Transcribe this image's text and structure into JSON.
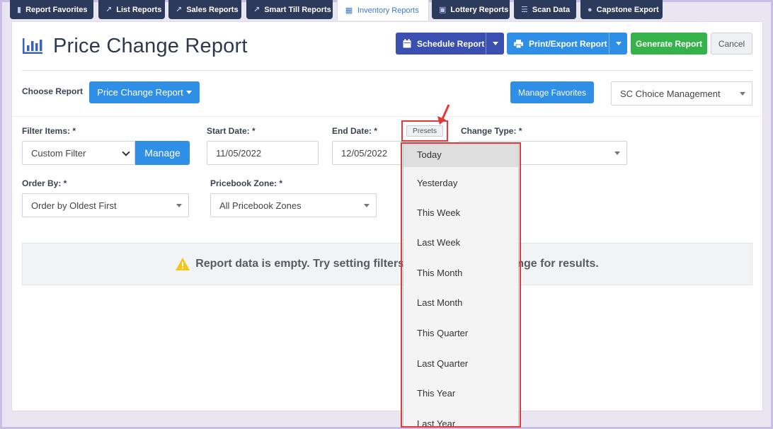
{
  "tabs": [
    {
      "label": "Report Favorites",
      "icon": "bookmark-icon"
    },
    {
      "label": "List Reports",
      "icon": "line-chart-icon"
    },
    {
      "label": "Sales Reports",
      "icon": "line-chart-icon"
    },
    {
      "label": "Smart Till Reports",
      "icon": "line-chart-icon"
    },
    {
      "label": "Inventory Reports",
      "icon": "barcode-icon",
      "active": true
    },
    {
      "label": "Lottery Reports",
      "icon": "ticket-icon"
    },
    {
      "label": "Scan Data",
      "icon": "list-icon"
    },
    {
      "label": "Capstone Export",
      "icon": "users-icon"
    }
  ],
  "header": {
    "title": "Price Change Report",
    "schedule_label": "Schedule Report",
    "print_label": "Print/Export Report",
    "generate_label": "Generate Report",
    "cancel_label": "Cancel"
  },
  "choose": {
    "label": "Choose Report",
    "report_button": "Price Change Report",
    "manage_favorites": "Manage Favorites",
    "company_value": "SC Choice Management"
  },
  "filters": {
    "filter_items_label": "Filter Items: *",
    "filter_items_value": "Custom Filter",
    "manage_label": "Manage",
    "start_label": "Start Date: *",
    "start_value": "11/05/2022",
    "end_label": "End Date: *",
    "end_value": "12/05/2022",
    "presets_label": "Presets",
    "change_type_label": "Change Type: *",
    "order_by_label": "Order By: *",
    "order_by_value": "Order by Oldest First",
    "pricebook_label": "Pricebook Zone: *",
    "pricebook_value": "All Pricebook Zones"
  },
  "empty_message": "Report data is empty. Try setting filters or a different date range for results.",
  "presets_menu": [
    "Today",
    "Yesterday",
    "This Week",
    "Last Week",
    "This Month",
    "Last Month",
    "This Quarter",
    "Last Quarter",
    "This Year",
    "Last Year"
  ],
  "colors": {
    "accent_blue": "#2f8fe6",
    "navy": "#3a4fb0",
    "green": "#35b24a",
    "highlight_red": "#e23a3a"
  }
}
